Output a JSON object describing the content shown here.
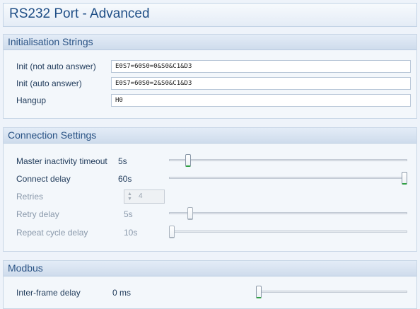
{
  "title": "RS232 Port - Advanced",
  "init_strings": {
    "header": "Initialisation Strings",
    "rows": [
      {
        "label": "Init (not auto answer)",
        "value": "E0S7=60S0=0&S0&C1&D3"
      },
      {
        "label": "Init (auto answer)",
        "value": "E0S7=60S0=2&S0&C1&D3"
      },
      {
        "label": "Hangup",
        "value": "H0"
      }
    ]
  },
  "connection": {
    "header": "Connection Settings",
    "master_timeout": {
      "label": "Master inactivity timeout",
      "value": "5s",
      "fraction": 0.07
    },
    "connect_delay": {
      "label": "Connect delay",
      "value": "60s",
      "fraction": 1.0
    },
    "retries": {
      "label": "Retries",
      "value": "4"
    },
    "retry_delay": {
      "label": "Retry delay",
      "value": "5s",
      "fraction": 0.08
    },
    "repeat_cycle_delay": {
      "label": "Repeat cycle delay",
      "value": "10s",
      "fraction": 0.0
    }
  },
  "modbus": {
    "header": "Modbus",
    "inter_frame": {
      "label": "Inter-frame delay",
      "value": "0 ms",
      "fraction": 0.0
    }
  }
}
